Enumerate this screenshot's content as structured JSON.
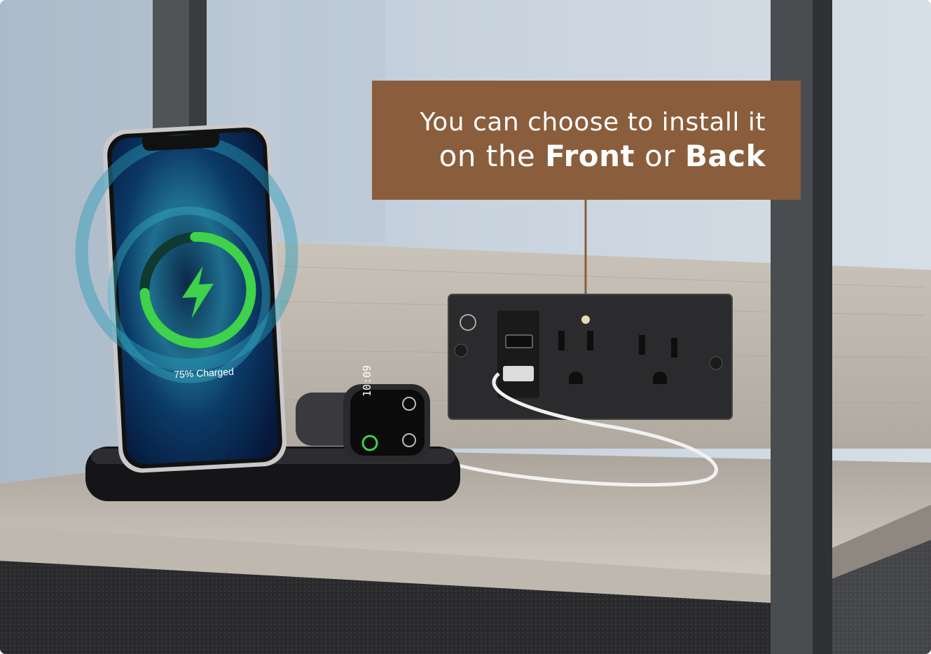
{
  "callout": {
    "line1": "You can choose to install it",
    "line2_prefix": "on the ",
    "line2_front": "Front",
    "line2_mid": " or ",
    "line2_back": "Back"
  },
  "phone": {
    "charge_label": "75% Charged",
    "charge_percent": 75
  },
  "watch": {
    "time": "10:09"
  },
  "colors": {
    "callout_bg": "#8a5e3c",
    "charge_ring": "#3fd24a",
    "wall": "#c9d3dd",
    "wood": "#b9b3aa",
    "outlet": "#2b2b2d"
  }
}
